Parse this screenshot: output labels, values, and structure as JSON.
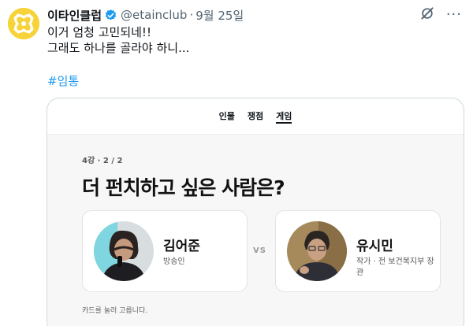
{
  "tweet": {
    "display_name": "이타인클럽",
    "handle": "@etainclub",
    "separator": "·",
    "time": "9월 25일",
    "more": "···",
    "text_lines": [
      "이거 엄청 고민되네!!",
      "그래도 하나를 골라야 하니..."
    ],
    "hashtag": "#임통"
  },
  "card": {
    "tabs": [
      {
        "label": "인물",
        "active": false
      },
      {
        "label": "쟁점",
        "active": false
      },
      {
        "label": "게임",
        "active": true
      }
    ],
    "round": "4강 · 2 / 2",
    "question": "더 펀치하고 싶은 사람은?",
    "candidates": [
      {
        "name": "김어준",
        "role": "방송인"
      },
      {
        "name": "유시민",
        "role": "작가 · 전 보건복지부 장관"
      }
    ],
    "vs": "VS",
    "hint": "카드를 눌러 고릅니다."
  },
  "colors": {
    "link_blue": "#1d9bf0",
    "verified_blue": "#1d9bf0",
    "avatar_yellow": "#f7d33a",
    "muted": "#536471"
  },
  "icons": [
    "avatar-logo",
    "verified-icon",
    "grok-icon",
    "more-icon"
  ]
}
